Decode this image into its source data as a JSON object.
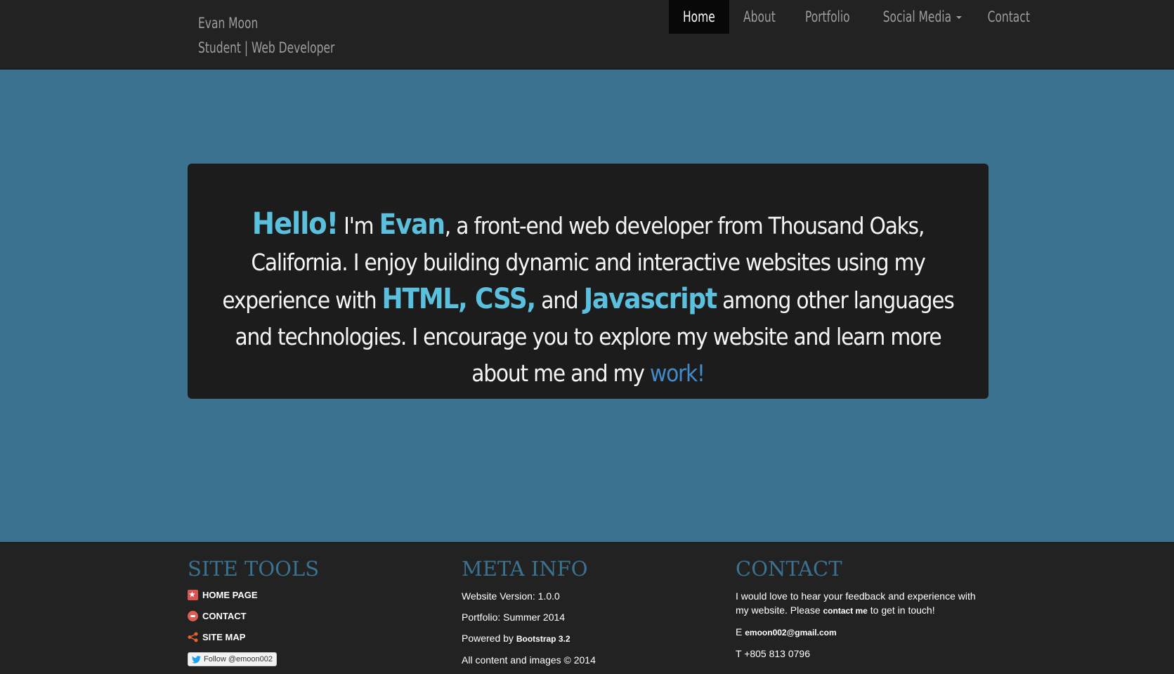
{
  "header": {
    "name": "Evan Moon",
    "tagline": "Student | Web Developer",
    "nav": [
      {
        "label": "Home",
        "active": true
      },
      {
        "label": "About"
      },
      {
        "label": "Portfolio"
      },
      {
        "label": "Social Media",
        "dropdown": true
      },
      {
        "label": "Contact"
      }
    ]
  },
  "hero": {
    "hello": "Hello!",
    "im": " I'm ",
    "name": "Evan",
    "text1": ", a front-end web developer from Thousand Oaks, California. I enjoy building dynamic and interactive websites using my experience with ",
    "skills": "HTML, CSS,",
    "text2": " and ",
    "js": "Javascript",
    "text3": " among other languages and technologies. I encourage you to explore my website and learn more about me and my ",
    "work": "work!"
  },
  "footer": {
    "site_tools": {
      "title": "SITE TOOLS",
      "home": "HOME PAGE",
      "contact": "CONTACT",
      "sitemap": "SITE MAP",
      "follow": "Follow @emoon002"
    },
    "meta": {
      "title": "META INFO",
      "version": "Website Version: 1.0.0",
      "portfolio": "Portfolio: Summer 2014",
      "powered_prefix": "Powered by ",
      "powered": "Bootstrap 3.2",
      "copyright": "All content and images © 2014"
    },
    "contact": {
      "title": "CONTACT",
      "text1": "I would love to hear your feedback and experience with my website. Please ",
      "link": "contact me",
      "text2": " to get in touch!",
      "email_prefix": "E ",
      "email": "emoon002@gmail.com",
      "phone": "T +805 813 0796"
    }
  },
  "colors": {
    "accent": "#5bc0de",
    "link": "#428bca",
    "bg": "#3a7290",
    "dark": "#222222"
  }
}
